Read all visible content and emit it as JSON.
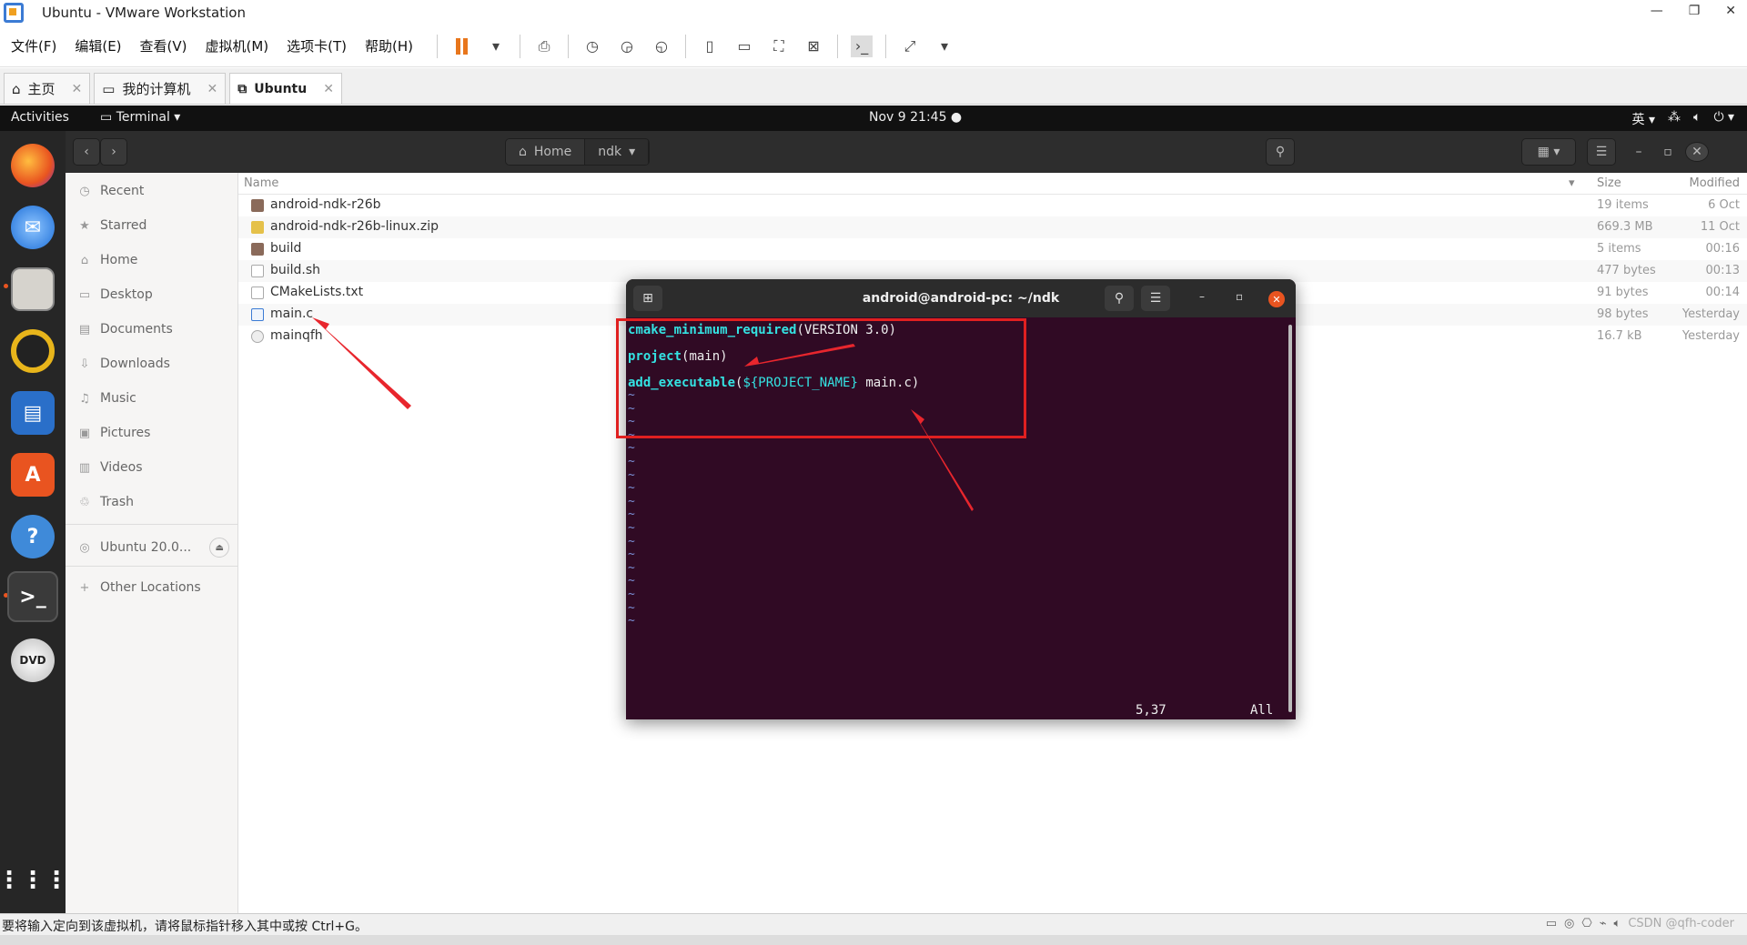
{
  "vmware": {
    "title": "Ubuntu - VMware Workstation",
    "menu": [
      "文件(F)",
      "编辑(E)",
      "查看(V)",
      "虚拟机(M)",
      "选项卡(T)",
      "帮助(H)"
    ],
    "tabs": [
      {
        "label": "主页"
      },
      {
        "label": "我的计算机"
      },
      {
        "label": "Ubuntu"
      }
    ],
    "status_message": "要将输入定向到该虚拟机，请将鼠标指针移入其中或按 Ctrl+G。",
    "watermark": "CSDN @qfh-coder"
  },
  "gnome": {
    "activities": "Activities",
    "app_menu": "Terminal ▾",
    "clock": "Nov 9  21:45",
    "input_method": "英 ▾"
  },
  "nautilus": {
    "path": [
      "Home",
      "ndk"
    ],
    "sidebar": [
      {
        "label": "Recent",
        "icon": "clock-icon"
      },
      {
        "label": "Starred",
        "icon": "star-icon"
      },
      {
        "label": "Home",
        "icon": "home-icon"
      },
      {
        "label": "Desktop",
        "icon": "desktop-icon"
      },
      {
        "label": "Documents",
        "icon": "document-icon"
      },
      {
        "label": "Downloads",
        "icon": "download-icon"
      },
      {
        "label": "Music",
        "icon": "music-icon"
      },
      {
        "label": "Pictures",
        "icon": "picture-icon"
      },
      {
        "label": "Videos",
        "icon": "video-icon"
      },
      {
        "label": "Trash",
        "icon": "trash-icon"
      },
      {
        "label": "Ubuntu 20.0...",
        "icon": "disc-icon"
      },
      {
        "label": "Other Locations",
        "icon": "plus-icon"
      }
    ],
    "columns": {
      "name": "Name",
      "size": "Size",
      "modified": "Modified"
    },
    "files": [
      {
        "name": "android-ndk-r26b",
        "size": "19 items",
        "modified": "6 Oct",
        "type": "folder"
      },
      {
        "name": "android-ndk-r26b-linux.zip",
        "size": "669.3 MB",
        "modified": "11 Oct",
        "type": "zip"
      },
      {
        "name": "build",
        "size": "5 items",
        "modified": "00:16",
        "type": "folder"
      },
      {
        "name": "build.sh",
        "size": "477 bytes",
        "modified": "00:13",
        "type": "script"
      },
      {
        "name": "CMakeLists.txt",
        "size": "91 bytes",
        "modified": "00:14",
        "type": "text"
      },
      {
        "name": "main.c",
        "size": "98 bytes",
        "modified": "Yesterday",
        "type": "c"
      },
      {
        "name": "mainqfh",
        "size": "16.7 kB",
        "modified": "Yesterday",
        "type": "binary"
      }
    ]
  },
  "terminal": {
    "title": "android@android-pc: ~/ndk",
    "lines": {
      "l1_fn": "cmake_minimum_required",
      "l1_rest": "(VERSION 3.0)",
      "l2_fn": "project",
      "l2_rest": "(main)",
      "l3_fn": "add_executable",
      "l3_open": "(",
      "l3_var": "${PROJECT_NAME}",
      "l3_rest": " main.c)"
    },
    "tilde": "~",
    "cursor_pos": "5,37",
    "scroll_pos": "All"
  }
}
